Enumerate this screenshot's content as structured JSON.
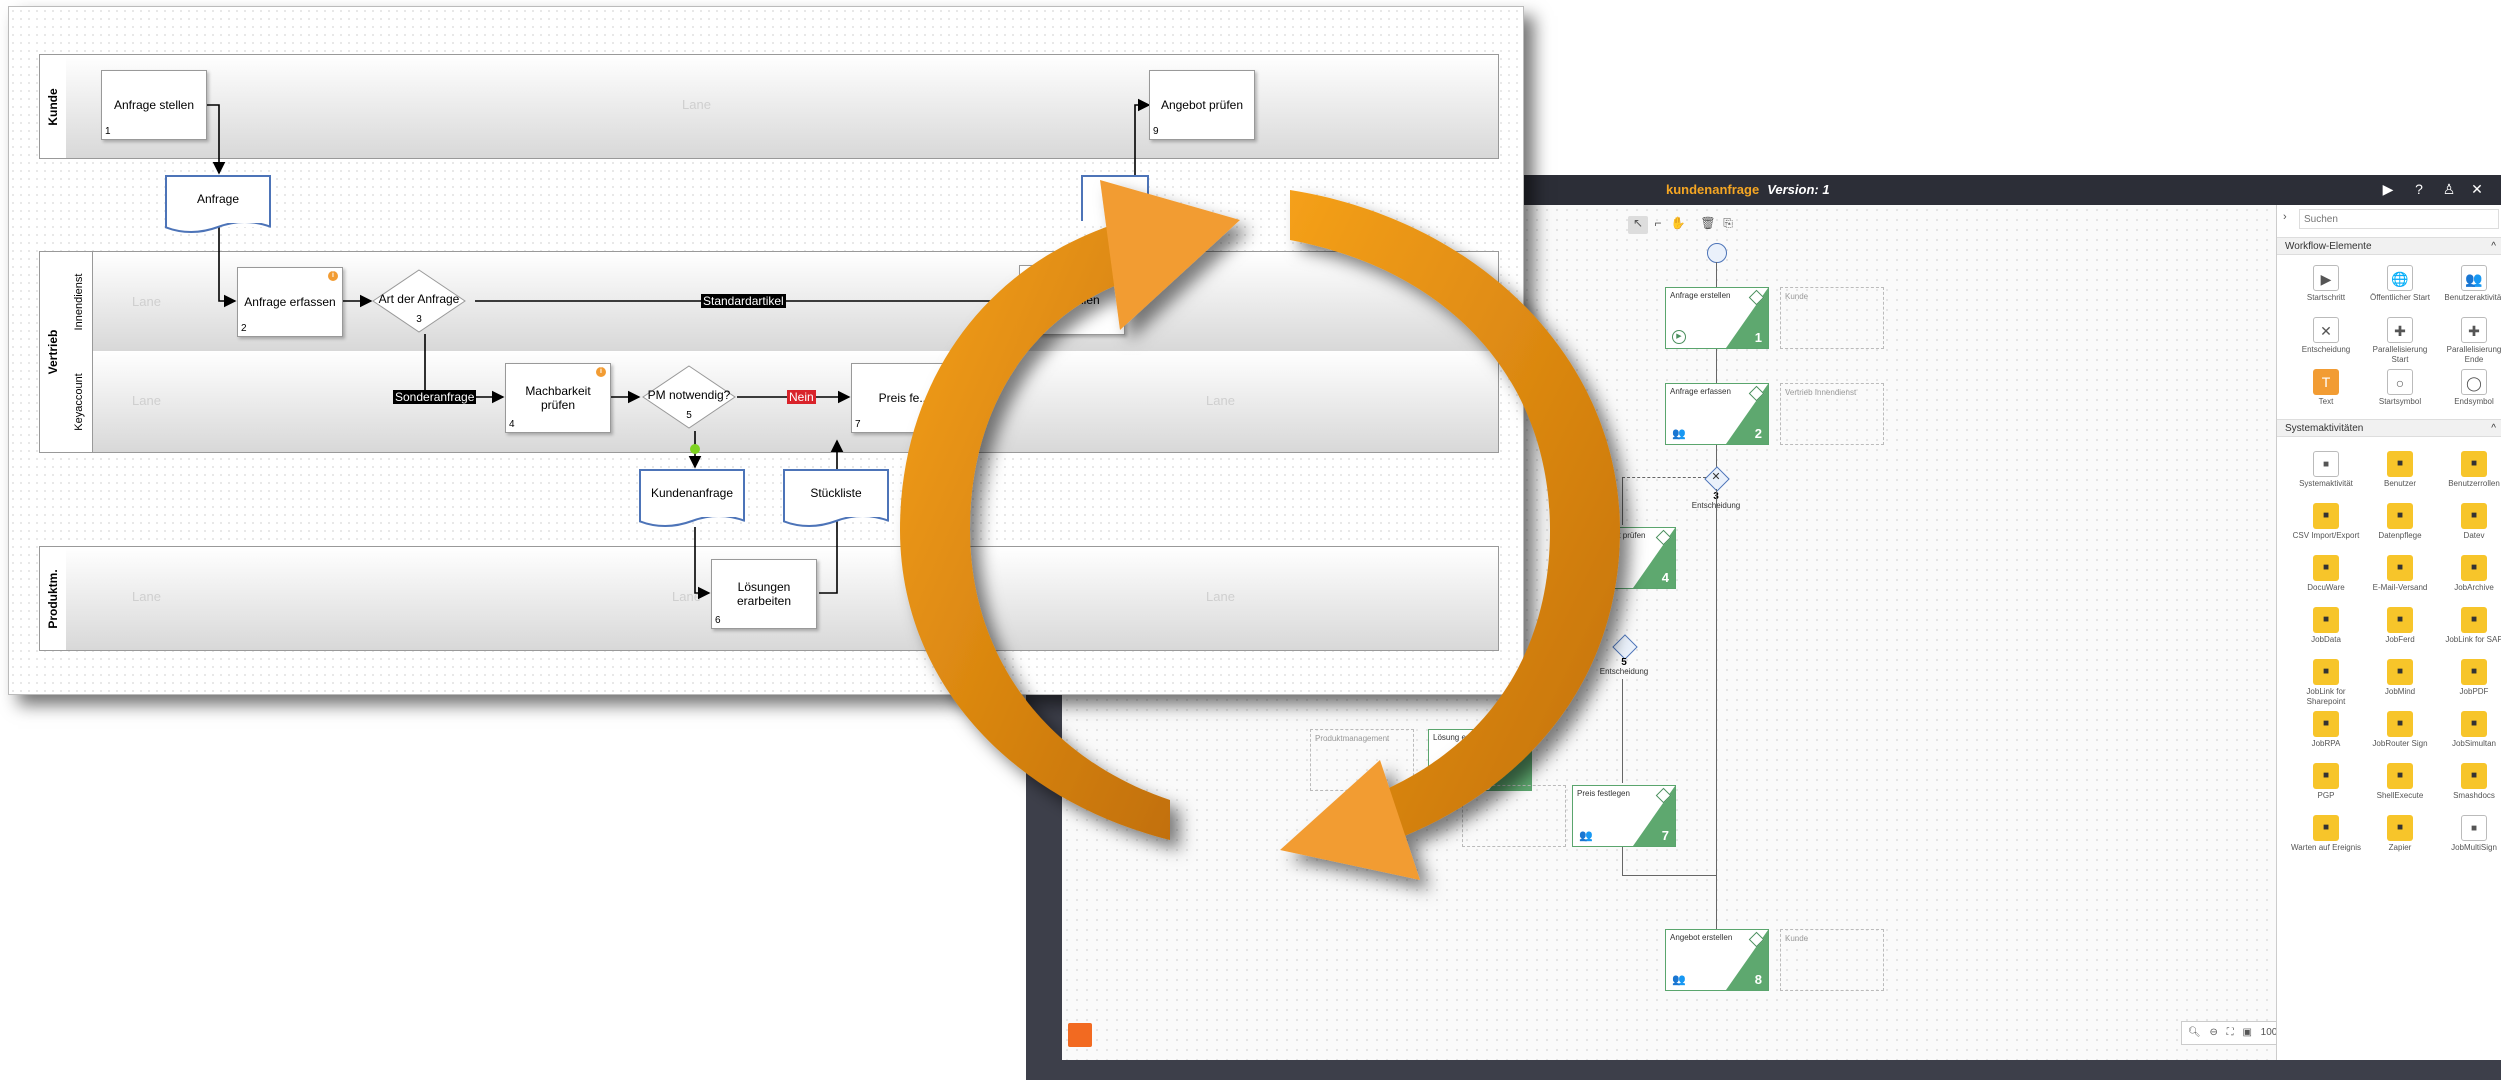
{
  "designer": {
    "title": "kundenanfrage",
    "version": "Version: 1",
    "search_placeholder": "Suchen",
    "zoom": "100%",
    "sections": {
      "workflow": "Workflow-Elemente",
      "system": "Systemaktivitäten"
    },
    "workflow_elements": [
      "Startschritt",
      "Öffentlicher Start",
      "Benutzeraktivität",
      "Entscheidung",
      "Parallelisierung Start",
      "Parallelisierung Ende",
      "Text",
      "Startsymbol",
      "Endsymbol"
    ],
    "system_activities": [
      "Systemaktivität",
      "Benutzer",
      "Benutzerrollen",
      "CSV Import/Export",
      "Datenpflege",
      "Datev",
      "DocuWare",
      "E-Mail-Versand",
      "JobArchive",
      "JobData",
      "JobFerd",
      "JobLink for SAP",
      "JobLink for Sharepoint",
      "JobMind",
      "JobPDF",
      "JobRPA",
      "JobRouter Sign",
      "JobSimultan",
      "PGP",
      "ShellExecute",
      "Smashdocs",
      "Warten auf Ereignis",
      "Zapier",
      "JobMultiSign"
    ],
    "nodes": [
      {
        "label": "Anfrage erstellen",
        "num": "1",
        "lane": "Kunde"
      },
      {
        "label": "Anfrage erfassen",
        "num": "2",
        "lane": "Vertrieb Innendienst"
      },
      {
        "label": "Machbarkeit prüfen",
        "num": "4",
        "lane": ""
      },
      {
        "label": "Lösung erarbeiten",
        "num": "",
        "lane": "Produktmanagement"
      },
      {
        "label": "Preis festlegen",
        "num": "7",
        "lane": ""
      },
      {
        "label": "Angebot erstellen",
        "num": "8",
        "lane": "Kunde"
      }
    ],
    "decision1": {
      "num": "3",
      "label": "Entscheidung"
    },
    "decision2": {
      "num": "5",
      "label": "Entscheidung"
    }
  },
  "swimlane": {
    "pools": {
      "kunde": "Kunde",
      "vertrieb": "Vertrieb",
      "produktm": "Produktm."
    },
    "lanes": {
      "innendienst": "Innendienst",
      "keyaccount": "Keyaccount"
    },
    "ghost_label": "Lane",
    "tasks": [
      {
        "label": "Anfrage stellen",
        "num": "1"
      },
      {
        "label": "Angebot prüfen",
        "num": "9"
      },
      {
        "label": "Anfrage erfassen",
        "num": "2"
      },
      {
        "label": "Machbarkeit prüfen",
        "num": "4"
      },
      {
        "label": "Preis fe...",
        "num": "7"
      },
      {
        "label": "Lösungen erarbeiten",
        "num": "6"
      },
      {
        "label": "...erstellen",
        "num": ""
      }
    ],
    "documents": [
      "Anfrage",
      "Kundenanfrage",
      "Stückliste"
    ],
    "gateways": [
      {
        "label": "Art der Anfrage",
        "num": "3"
      },
      {
        "label": "PM notwendig?",
        "num": "5"
      }
    ],
    "edge_labels": {
      "standard": "Standardartikel",
      "sonder": "Sonderanfrage",
      "nein": "Nein"
    }
  },
  "colors": {
    "accent_orange": "#f29c33",
    "node_green": "#5ea86f",
    "doc_blue": "#4d74b8"
  }
}
